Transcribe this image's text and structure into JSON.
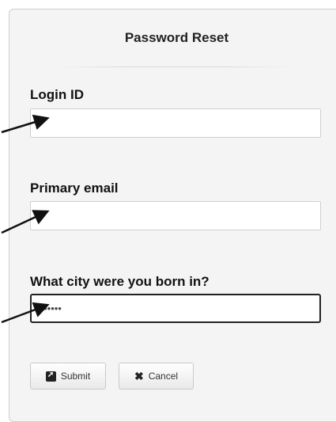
{
  "form": {
    "title": "Password Reset",
    "fields": [
      {
        "label": "Login ID",
        "value": "",
        "placeholder": ""
      },
      {
        "label": "Primary email",
        "value": "",
        "placeholder": ""
      },
      {
        "label": "What city were you born in?",
        "value": "•••••••",
        "placeholder": ""
      }
    ],
    "buttons": {
      "submit_label": "Submit",
      "submit_icon": "share-square-icon",
      "cancel_label": "Cancel",
      "cancel_icon": "x-icon"
    }
  }
}
